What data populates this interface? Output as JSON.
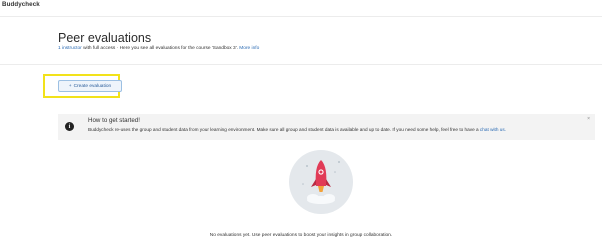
{
  "header": {
    "brand": "Buddycheck"
  },
  "page": {
    "title": "Peer evaluations",
    "instructor_link": "1 instructor",
    "subtitle_text": " with full access · Here you see all evaluations for the course 'Sandbox 3'. ",
    "more_info_link": "More info"
  },
  "toolbar": {
    "create_label": "Create evaluation",
    "create_icon": "+"
  },
  "notice": {
    "icon": "info-icon",
    "title": "How to get started!",
    "body": "Buddycheck re-uses the group and student data from your learning environment. Make sure all group and student data is available and up to date.  If you need some help, feel free to have a ",
    "chat_link": "chat with us.",
    "close_glyph": "×"
  },
  "empty_state": {
    "illustration": "rocket-illustration",
    "text": "No evaluations yet. Use peer evaluations to boost your insights in group collaboration."
  },
  "colors": {
    "link": "#2a6ab3",
    "highlight": "#f2e21a",
    "rocket": "#e13b57"
  }
}
